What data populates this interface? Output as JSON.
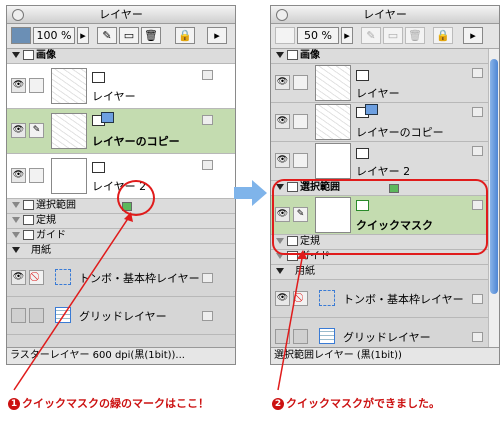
{
  "left_panel": {
    "title": "レイヤー",
    "zoom": "100 %",
    "folder_image": "画像",
    "layers": [
      {
        "name": "レイヤー",
        "selected": false
      },
      {
        "name": "レイヤーのコピー",
        "selected": true
      },
      {
        "name": "レイヤー 2",
        "selected": false
      }
    ],
    "folders": [
      "選択範囲",
      "定規",
      "ガイド"
    ],
    "paper": "用紙",
    "paper_layers": [
      "トンボ・基本枠レイヤー",
      "グリッドレイヤー"
    ],
    "status": "ラスターレイヤー 600 dpi(黒(1bit))..."
  },
  "right_panel": {
    "title": "レイヤー",
    "zoom": "50 %",
    "folder_image": "画像",
    "layers": [
      {
        "name": "レイヤー"
      },
      {
        "name": "レイヤーのコピー"
      },
      {
        "name": "レイヤー 2"
      }
    ],
    "selection_folder": "選択範囲",
    "quickmask": "クイックマスク",
    "ruler": "定規",
    "guide": "ガイド",
    "paper": "用紙",
    "paper_layers": [
      "トンボ・基本枠レイヤー",
      "グリッドレイヤー"
    ],
    "status": "選択範囲レイヤー (黒(1bit))"
  },
  "captions": {
    "num1": "1",
    "text1": "クイックマスクの緑のマークはここ！",
    "num2": "2",
    "text2": "クイックマスクができました。"
  },
  "colors": {
    "accent_red": "#e01b1b",
    "selection_green": "#c4dcb0",
    "arrow_blue": "#7fb4ea"
  }
}
